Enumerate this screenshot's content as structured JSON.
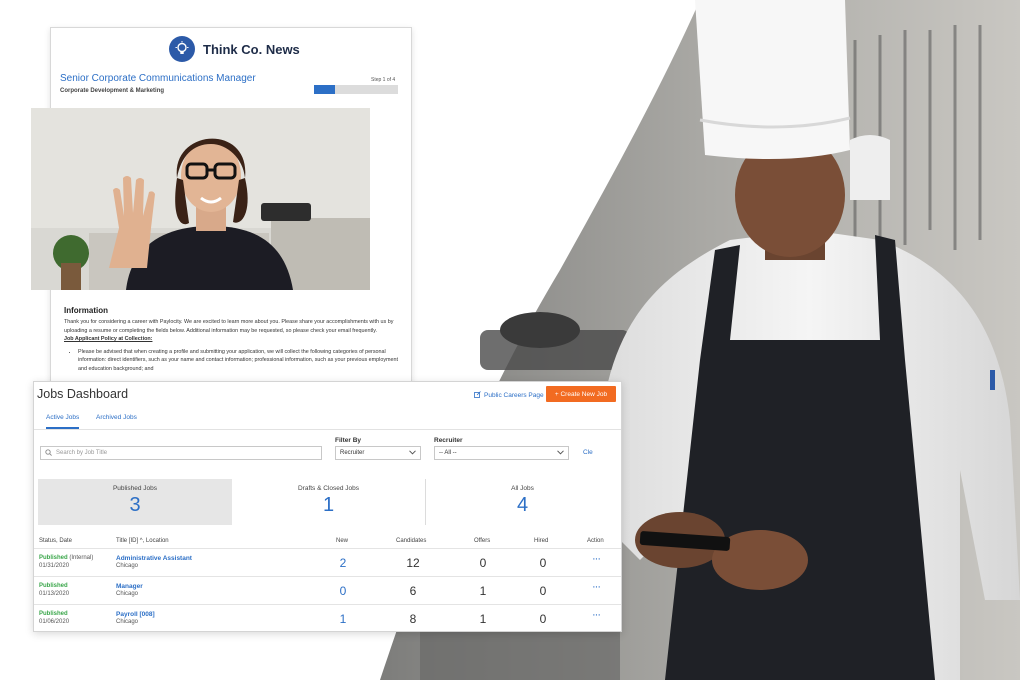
{
  "application": {
    "brand": "Think Co. News",
    "job_title": "Senior Corporate Communications Manager",
    "department": "Corporate Development & Marketing",
    "step": "Step 1 of 4",
    "progress_fraction": 0.25,
    "info_heading": "Information",
    "info_text": "Thank you for considering a career with Paylocity. We are excited to learn more about you. Please share your accomplishments with us by uploading a resume or completing the fields below. Additional information may be requested, so please check your email frequently.",
    "policy_heading": "Job Applicant Policy at Collection:",
    "policy_bullet": "Please be advised that when creating a profile and submitting your application, we will collect the following categories of personal information: direct identifiers, such as your name and contact information; professional information, such as your previous employment and education background; and"
  },
  "dashboard": {
    "title": "Jobs Dashboard",
    "careers_link": "Public Careers Page",
    "create_button": "+ Create New Job",
    "tabs": [
      {
        "label": "Active Jobs",
        "active": true
      },
      {
        "label": "Archived Jobs",
        "active": false
      }
    ],
    "search_placeholder": "Search by Job Title",
    "filter_by_label": "Filter By",
    "filter_by_value": "Recruiter",
    "recruiter_label": "Recruiter",
    "recruiter_value": "-- All --",
    "clear_label": "Cle",
    "stats": [
      {
        "label": "Published Jobs",
        "value": "3"
      },
      {
        "label": "Drafts & Closed Jobs",
        "value": "1"
      },
      {
        "label": "All Jobs",
        "value": "4"
      }
    ],
    "columns": {
      "status": "Status, Date",
      "title": "Title [ID] ^, Location",
      "new": "New",
      "candidates": "Candidates",
      "offers": "Offers",
      "hired": "Hired",
      "action": "Action"
    },
    "rows": [
      {
        "status": "Published",
        "status_extra": "(Internal)",
        "date": "01/31/2020",
        "title": "Administrative Assistant",
        "location": "Chicago",
        "new": "2",
        "candidates": "12",
        "offers": "0",
        "hired": "0",
        "action": "···"
      },
      {
        "status": "Published",
        "status_extra": "",
        "date": "01/13/2020",
        "title": "Manager",
        "location": "Chicago",
        "new": "0",
        "candidates": "6",
        "offers": "1",
        "hired": "0",
        "action": "···"
      },
      {
        "status": "Published",
        "status_extra": "",
        "date": "01/06/2020",
        "title": "Payroll [008]",
        "location": "Chicago",
        "new": "1",
        "candidates": "8",
        "offers": "1",
        "hired": "0",
        "action": "···"
      }
    ]
  },
  "colors": {
    "accent_blue": "#2c6fc6",
    "create_orange": "#f26b21",
    "published_green": "#3aa64a"
  }
}
